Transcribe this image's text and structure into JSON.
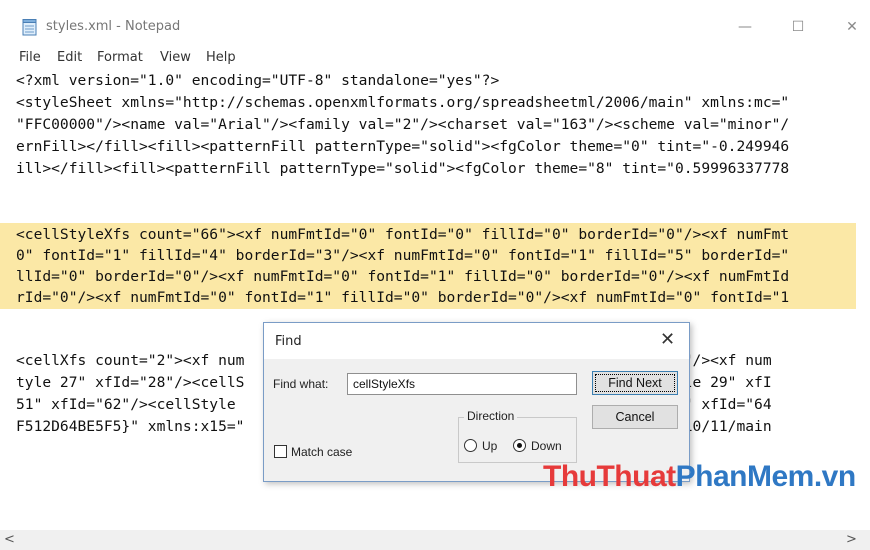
{
  "window": {
    "title": "styles.xml - Notepad",
    "controls": {
      "minimize": "—",
      "maximize": "☐",
      "close": "✕"
    }
  },
  "menu": [
    "File",
    "Edit",
    "Format",
    "View",
    "Help"
  ],
  "editor": {
    "lines": [
      "<?xml version=\"1.0\" encoding=\"UTF-8\" standalone=\"yes\"?>",
      "<styleSheet xmlns=\"http://schemas.openxmlformats.org/spreadsheetml/2006/main\" xmlns:mc=\"",
      "\"FFC00000\"/><name val=\"Arial\"/><family val=\"2\"/><charset val=\"163\"/><scheme val=\"minor\"/",
      "ernFill></fill><fill><patternFill patternType=\"solid\"><fgColor theme=\"0\" tint=\"-0.249946",
      "ill></fill><fill><patternFill patternType=\"solid\"><fgColor theme=\"8\" tint=\"0.59996337778",
      "",
      "",
      "<cellStyleXfs count=\"66\"><xf numFmtId=\"0\" fontId=\"0\" fillId=\"0\" borderId=\"0\"/><xf numFmt",
      "0\" fontId=\"1\" fillId=\"4\" borderId=\"3\"/><xf numFmtId=\"0\" fontId=\"1\" fillId=\"5\" borderId=\"",
      "llId=\"0\" borderId=\"0\"/><xf numFmtId=\"0\" fontId=\"1\" fillId=\"0\" borderId=\"0\"/><xf numFmtId",
      "rId=\"0\"/><xf numFmtId=\"0\" fontId=\"1\" fillId=\"0\" borderId=\"0\"/><xf numFmtId=\"0\" fontId=\"1",
      "",
      "",
      "<cellXfs count=\"2\"><xf num                                           xfId=\"0\"/><xf num",
      "tyle 27\" xfId=\"28\"/><cellS                                          ame=\"Style 29\" xfI",
      "51\" xfId=\"62\"/><cellStyle                                           Style 53\" xfId=\"64",
      "F512D64BE5F5}\" xmlns:x15=\"                                          eetml/2010/11/main"
    ],
    "highlight_color": "#fbe8a6"
  },
  "find_dialog": {
    "title": "Find",
    "find_what_label": "Find what:",
    "find_what_value": "cellStyleXfs",
    "find_next_label": "Find Next",
    "cancel_label": "Cancel",
    "direction_label": "Direction",
    "up_label": "Up",
    "down_label": "Down",
    "direction_selected": "Down",
    "match_case_label": "Match case",
    "match_case_checked": false
  },
  "watermark": {
    "part1": "ThuThuat",
    "part2": "PhanMem",
    "part3": ".vn",
    "color1": "#e63a3a",
    "color2": "#2f78c4"
  },
  "scrollbar": {
    "left_arrow": "<",
    "right_arrow": ">"
  }
}
